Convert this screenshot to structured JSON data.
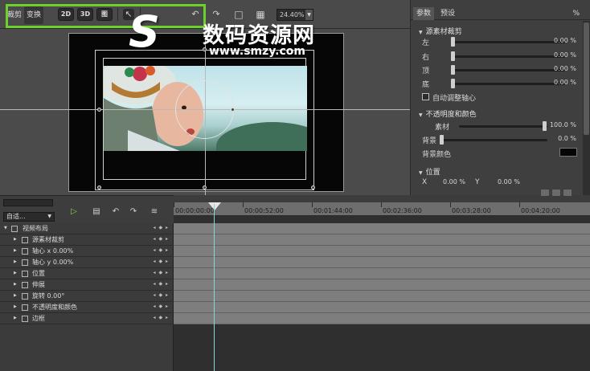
{
  "toolbar": {
    "tab_crop": "裁剪",
    "tab_transform": "变换",
    "btn_2d": "2D",
    "btn_3d": "3D",
    "btn_layout": "图",
    "zoom_value": "24.40%",
    "icons": [
      "pointer-icon",
      "undo-icon",
      "redo-icon",
      "fit-icon",
      "grid-icon"
    ]
  },
  "watermark": {
    "logo": "S",
    "title": "数码资源网",
    "url": "www.smzy.com"
  },
  "right_panel": {
    "tabs": [
      "参数",
      "预设"
    ],
    "percent_mark": "%",
    "crop_section": "源素材裁剪",
    "crop_rows": [
      {
        "label": "左",
        "value": "0.00 %"
      },
      {
        "label": "右",
        "value": "0.00 %"
      },
      {
        "label": "顶",
        "value": "0.00 %"
      },
      {
        "label": "底",
        "value": "0.00 %"
      }
    ],
    "auto_adjust": "自动调整轴心",
    "opacity_section": "不透明度和颜色",
    "material_label": "素材",
    "material_value": "100.0 %",
    "background_label": "背景",
    "background_value": "0.0 %",
    "bg_color_label": "背景颜色",
    "bg_color": "#050505",
    "position_section": "位置",
    "x_label": "X",
    "x_value": "0.00 %",
    "y_label": "Y",
    "y_value": "0.00 %"
  },
  "timeline": {
    "mode_select": "自适...",
    "ruler_labels": [
      "00:00:00:00",
      "00:00:52:00",
      "00:01:44:00",
      "00:02:36:00",
      "00:03:28:00",
      "00:04:20:00"
    ],
    "tracks": [
      {
        "label": "视频布局",
        "root": true
      },
      {
        "label": "源素材裁剪"
      },
      {
        "label": "轴心 x  0.00%"
      },
      {
        "label": "轴心 y  0.00%"
      },
      {
        "label": "位置"
      },
      {
        "label": "伸展"
      },
      {
        "label": "旋转  0.00°"
      },
      {
        "label": "不透明度和颜色"
      },
      {
        "label": "边框"
      }
    ],
    "keyframe_glyph": "◂ ◆ ▸"
  }
}
